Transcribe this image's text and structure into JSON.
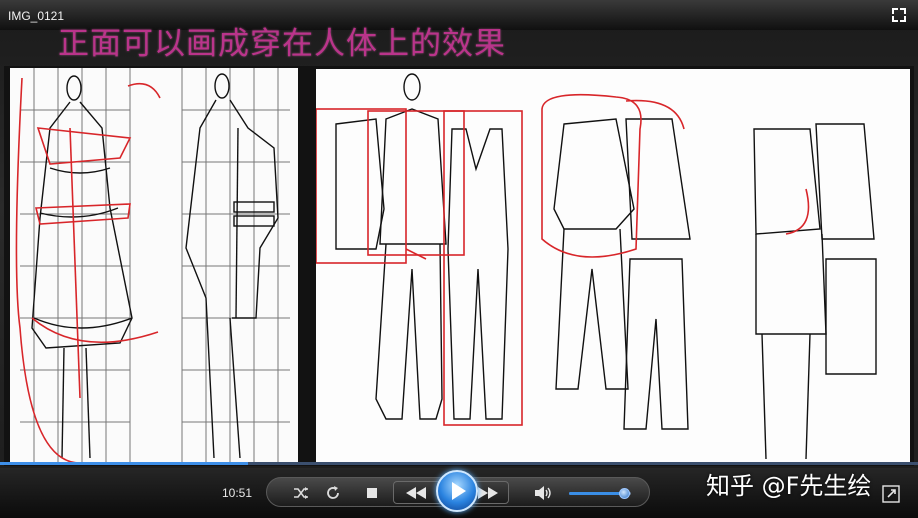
{
  "window": {
    "title": "IMG_0121"
  },
  "overlay": {
    "caption": "正面可以画成穿在人体上的效果"
  },
  "player": {
    "time": "10:51",
    "progress_fraction": 0.27,
    "volume_fraction": 0.9,
    "icons": [
      "fullscreen-toggle-icon",
      "shuffle-icon",
      "repeat-icon",
      "stop-icon",
      "rewind-icon",
      "play-icon",
      "fast-forward-icon",
      "volume-icon",
      "expand-icon"
    ]
  },
  "watermark": {
    "text": "知乎 @F先生绘"
  },
  "colors": {
    "accent": "#3e8fe8",
    "caption": "#e23aa7",
    "annotation": "#d8262a"
  }
}
